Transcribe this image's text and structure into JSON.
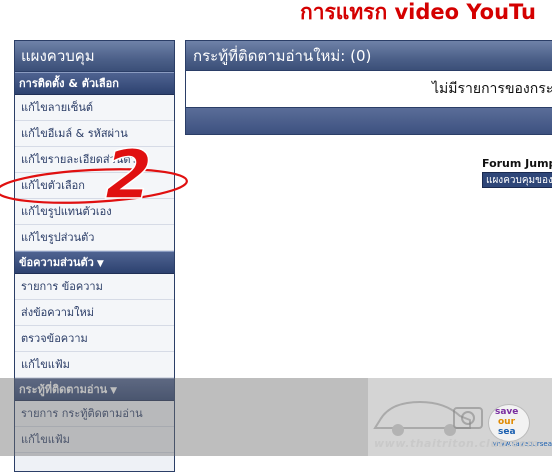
{
  "banner": {
    "title": "การแทรก video YouTu"
  },
  "sidebar": {
    "title": "แผงควบคุม",
    "sections": [
      {
        "label": "การติดตั้ง & ตัวเลือก",
        "items": [
          "แก้ไขลายเซ็นต์",
          "แก้ไขอีเมล์ & รหัสผ่าน",
          "แก้ไขรายละเอียดส่วนตัว",
          "แก้ไขตัวเลือก",
          "แก้ไขรูปแทนตัวเอง",
          "แก้ไขรูปส่วนตัว"
        ]
      },
      {
        "label": "ข้อความส่วนตัว",
        "items": [
          "รายการ ข้อความ",
          "ส่งข้อความใหม่",
          "ตรวจข้อความ",
          "แก้ไขแฟ้ม"
        ]
      },
      {
        "label": "กระทู้ที่ติดตามอ่าน",
        "items": [
          "รายการ กระทู้ติดตามอ่าน",
          "แก้ไขแฟ้ม"
        ]
      }
    ]
  },
  "panel": {
    "title": "กระทู้ที่ติดตามอ่านใหม่: (0)",
    "message": "ไม่มีรายการของกระ"
  },
  "forum_jump": {
    "label": "Forum Jump",
    "selected": "แผงควบคุมของผู้ใช้"
  },
  "annotation": {
    "number": "2",
    "color": "#e01010"
  },
  "watermark": {
    "url": "www.thaitriton.club.com",
    "logo": [
      "save",
      "our",
      "sea"
    ],
    "small": "www.saveoursea.net"
  },
  "colors": {
    "header_blue": "#4c6089",
    "banner_red": "#d40000"
  }
}
